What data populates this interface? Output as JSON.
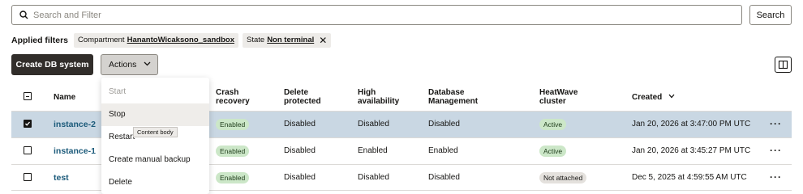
{
  "search": {
    "placeholder": "Search and Filter",
    "button_label": "Search"
  },
  "filters": {
    "label": "Applied filters",
    "chips": [
      {
        "key": "Compartment",
        "value": "HanantoWicaksono_sandbox"
      },
      {
        "key": "State",
        "value": "Non terminal"
      }
    ]
  },
  "toolbar": {
    "create_label": "Create DB system",
    "actions_label": "Actions"
  },
  "table": {
    "headers": {
      "name": "Name",
      "crash": [
        "Crash",
        "recovery"
      ],
      "delete": [
        "Delete",
        "protected"
      ],
      "ha": [
        "High",
        "availability"
      ],
      "dbm": [
        "Database",
        "Management"
      ],
      "hw": [
        "HeatWave",
        "cluster"
      ],
      "created": "Created"
    },
    "rows": [
      {
        "selected": true,
        "name": "instance-2",
        "crash": "Enabled",
        "delete": "Disabled",
        "ha": "Disabled",
        "dbm": "Disabled",
        "hw": "Active",
        "created": "Jan 20, 2026 at 3:47:00 PM UTC"
      },
      {
        "selected": false,
        "name": "instance-1",
        "crash": "Enabled",
        "delete": "Disabled",
        "ha": "Enabled",
        "dbm": "Enabled",
        "hw": "Active",
        "created": "Jan 20, 2026 at 3:45:27 PM UTC"
      },
      {
        "selected": false,
        "name": "test",
        "crash": "Enabled",
        "delete": "Disabled",
        "ha": "Disabled",
        "dbm": "Disabled",
        "hw": "Not attached",
        "created": "Dec 5, 2025 at 4:59:55 AM UTC"
      }
    ]
  },
  "actions_menu": {
    "items": [
      {
        "label": "Start",
        "disabled": true
      },
      {
        "label": "Stop",
        "disabled": false
      },
      {
        "label": "Restart",
        "disabled": false
      },
      {
        "label": "Create manual backup",
        "disabled": false
      },
      {
        "label": "Delete",
        "disabled": false
      }
    ],
    "tooltip": "Content body"
  },
  "colors": {
    "primary_button": "#312d2a",
    "selected_row": "#c9d7e3",
    "link": "#1b5a7a",
    "badge_green": "#cce7c8"
  }
}
